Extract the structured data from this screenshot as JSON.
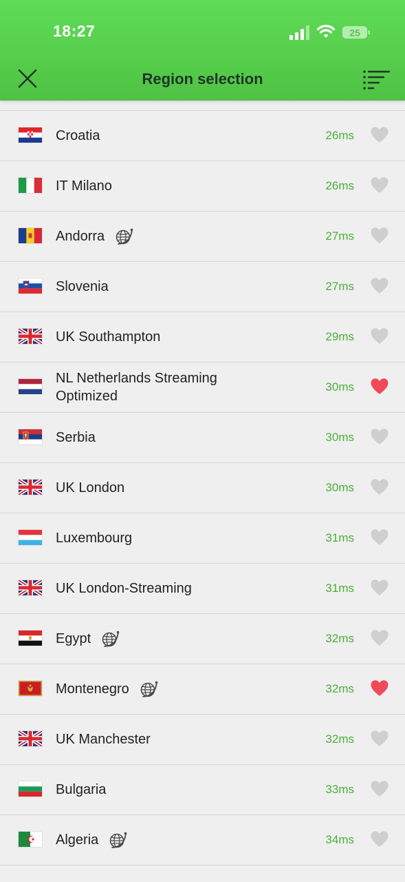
{
  "status_bar": {
    "time": "18:27",
    "battery_level": "25"
  },
  "header": {
    "title": "Region selection",
    "close_icon": "close-icon",
    "sort_icon": "sort-icon"
  },
  "colors": {
    "header_green": "#56cf4c",
    "ping_green": "#4cae3c",
    "favorite_red": "#f04a5a",
    "heart_gray": "#cfcfcf"
  },
  "regions": [
    {
      "name": "Croatia",
      "ping": "26ms",
      "flag": "croatia",
      "globe": false,
      "favorite": false
    },
    {
      "name": "IT Milano",
      "ping": "26ms",
      "flag": "italy",
      "globe": false,
      "favorite": false
    },
    {
      "name": "Andorra",
      "ping": "27ms",
      "flag": "andorra",
      "globe": true,
      "favorite": false
    },
    {
      "name": "Slovenia",
      "ping": "27ms",
      "flag": "slovenia",
      "globe": false,
      "favorite": false
    },
    {
      "name": "UK Southampton",
      "ping": "29ms",
      "flag": "uk",
      "globe": false,
      "favorite": false
    },
    {
      "name": "NL Netherlands Streaming Optimized",
      "ping": "30ms",
      "flag": "netherlands",
      "globe": false,
      "favorite": true
    },
    {
      "name": "Serbia",
      "ping": "30ms",
      "flag": "serbia",
      "globe": false,
      "favorite": false
    },
    {
      "name": "UK London",
      "ping": "30ms",
      "flag": "uk",
      "globe": false,
      "favorite": false
    },
    {
      "name": "Luxembourg",
      "ping": "31ms",
      "flag": "luxembourg",
      "globe": false,
      "favorite": false
    },
    {
      "name": "UK London-Streaming",
      "ping": "31ms",
      "flag": "uk",
      "globe": false,
      "favorite": false
    },
    {
      "name": "Egypt",
      "ping": "32ms",
      "flag": "egypt",
      "globe": true,
      "favorite": false
    },
    {
      "name": "Montenegro",
      "ping": "32ms",
      "flag": "montenegro",
      "globe": true,
      "favorite": true
    },
    {
      "name": "UK Manchester",
      "ping": "32ms",
      "flag": "uk",
      "globe": false,
      "favorite": false
    },
    {
      "name": "Bulgaria",
      "ping": "33ms",
      "flag": "bulgaria",
      "globe": false,
      "favorite": false
    },
    {
      "name": "Algeria",
      "ping": "34ms",
      "flag": "algeria",
      "globe": true,
      "favorite": false
    }
  ]
}
